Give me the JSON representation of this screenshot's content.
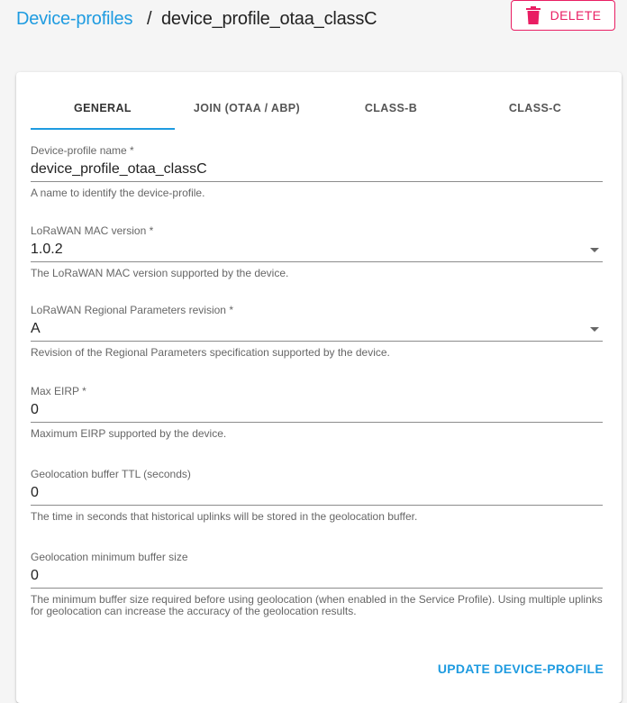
{
  "breadcrumb": {
    "parent": "Device-profiles",
    "separator": "/",
    "current": "device_profile_otaa_classC"
  },
  "actions": {
    "delete_label": "DELETE",
    "delete_icon": "trash-icon",
    "delete_color": "#e91e63"
  },
  "tabs": [
    {
      "label": "GENERAL",
      "active": true
    },
    {
      "label": "JOIN (OTAA / ABP)",
      "active": false
    },
    {
      "label": "CLASS-B",
      "active": false
    },
    {
      "label": "CLASS-C",
      "active": false
    }
  ],
  "fields": {
    "name": {
      "label": "Device-profile name *",
      "value": "device_profile_otaa_classC",
      "help": "A name to identify the device-profile."
    },
    "mac_version": {
      "label": "LoRaWAN MAC version *",
      "value": "1.0.2",
      "help": "The LoRaWAN MAC version supported by the device."
    },
    "reg_params": {
      "label": "LoRaWAN Regional Parameters revision *",
      "value": "A",
      "help": "Revision of the Regional Parameters specification supported by the device."
    },
    "max_eirp": {
      "label": "Max EIRP *",
      "value": "0",
      "help": "Maximum EIRP supported by the device."
    },
    "geo_ttl": {
      "label": "Geolocation buffer TTL (seconds)",
      "value": "0",
      "help": "The time in seconds that historical uplinks will be stored in the geolocation buffer."
    },
    "geo_min": {
      "label": "Geolocation minimum buffer size",
      "value": "0",
      "help": "The minimum buffer size required before using geolocation (when enabled in the Service Profile). Using multiple uplinks for geolocation can increase the accuracy of the geolocation results."
    }
  },
  "submit": {
    "label": "UPDATE DEVICE-PROFILE"
  },
  "colors": {
    "accent": "#1e9be0",
    "danger": "#e91e63"
  }
}
